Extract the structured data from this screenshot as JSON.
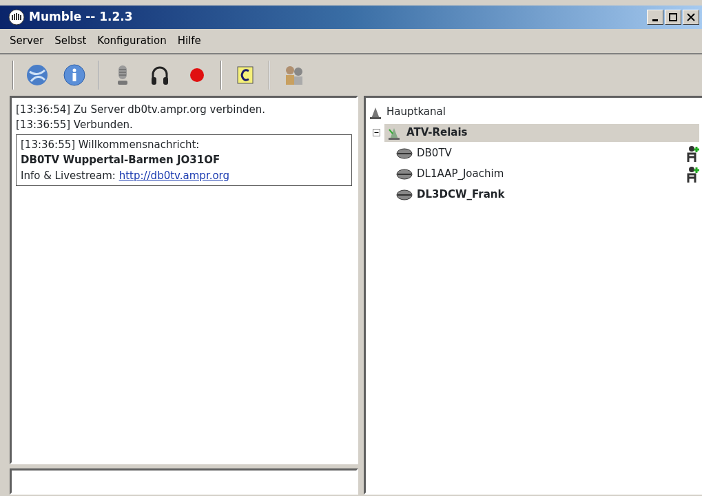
{
  "window": {
    "title": "Mumble -- 1.2.3"
  },
  "menu": [
    "Server",
    "Selbst",
    "Konfiguration",
    "Hilfe"
  ],
  "log": {
    "lines": [
      "[13:36:54] Zu Server db0tv.ampr.org verbinden.",
      "[13:36:55] Verbunden."
    ],
    "welcome": {
      "header": "[13:36:55] Willkommensnachricht:",
      "headline": "DB0TV Wuppertal-Barmen JO31OF",
      "label": "Info & Livestream:",
      "link": "http://db0tv.ampr.org"
    }
  },
  "tree": {
    "name": "Hauptkanal",
    "children": [
      {
        "kind": "channel",
        "name": "ATV-Relais",
        "expanded": true,
        "selected": true,
        "children": [
          {
            "kind": "user",
            "name": "DB0TV",
            "self": false,
            "registered": true
          },
          {
            "kind": "user",
            "name": "DL1AAP_Joachim",
            "self": false,
            "registered": true
          },
          {
            "kind": "user",
            "name": "DL3DCW_Frank",
            "self": true,
            "registered": false
          }
        ]
      }
    ]
  }
}
